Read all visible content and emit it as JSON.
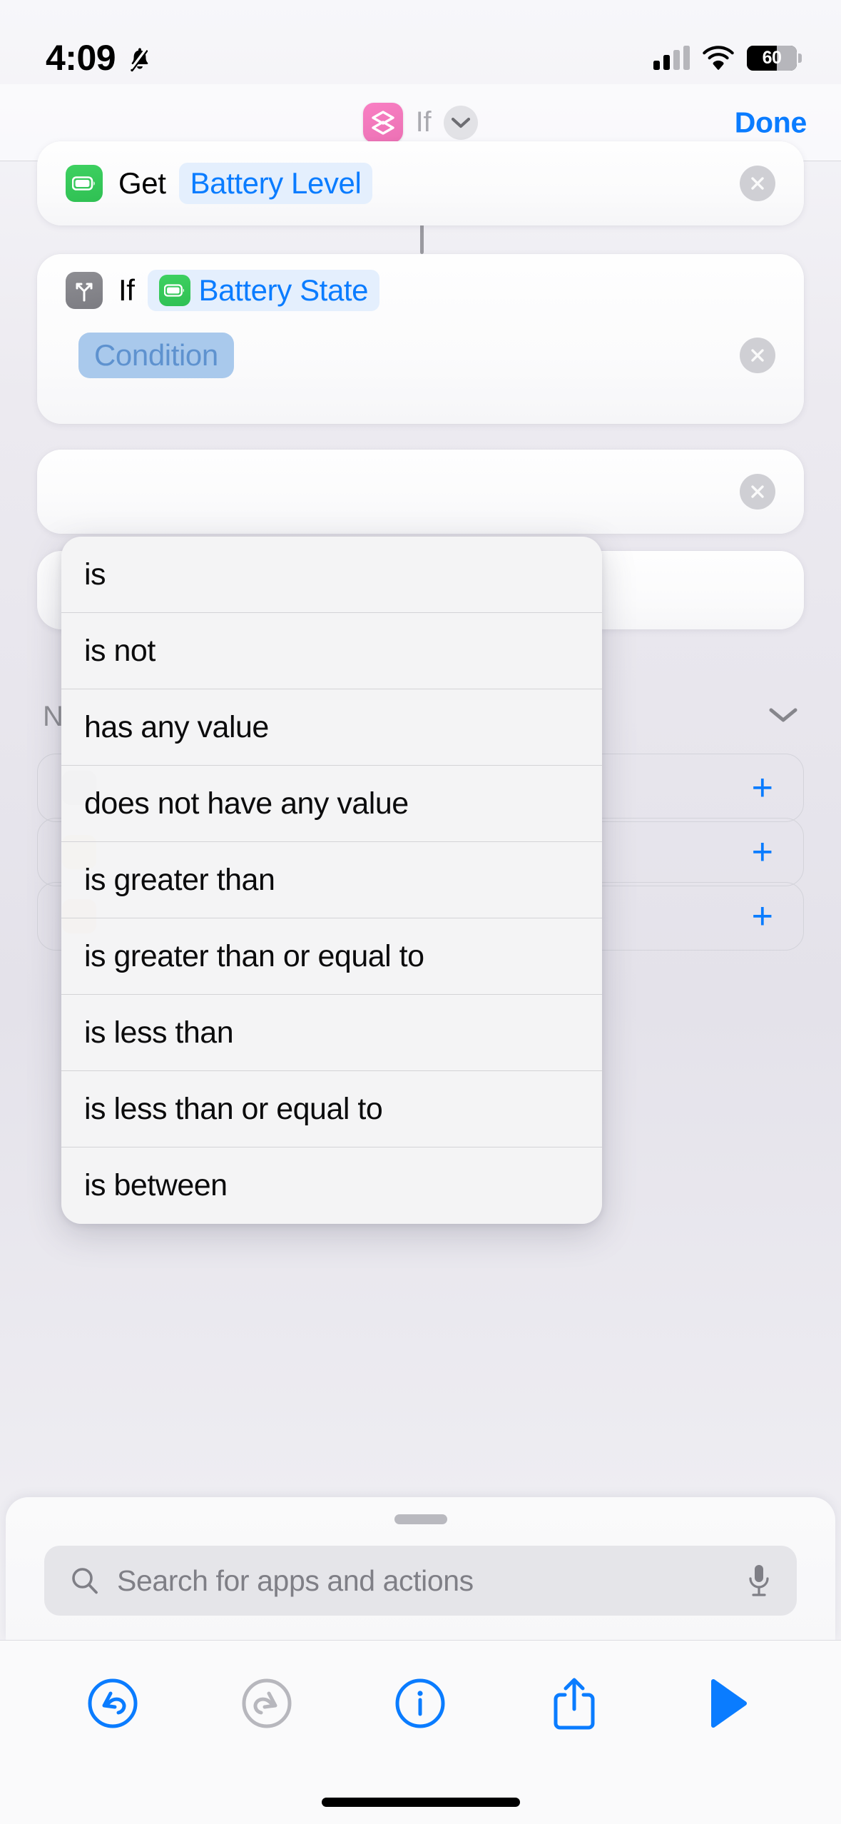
{
  "status_bar": {
    "time": "4:09",
    "silent_icon": "bell-slash-icon",
    "cellular_icon": "cellular-bars-icon",
    "wifi_icon": "wifi-icon",
    "battery_percent": "60",
    "battery_level": 60
  },
  "nav_bar": {
    "app_icon": "shortcuts-layers-icon",
    "title": "If",
    "chevron_icon": "chevron-down-icon",
    "done_label": "Done",
    "accent_color": "#0a7cff",
    "app_icon_color": "#f178bb"
  },
  "actions": [
    {
      "icon": "battery-icon",
      "icon_color": "#2fc053",
      "verb": "Get",
      "token": "Battery Level",
      "token_color": "#0a7cff",
      "close_icon": "close-circle-icon"
    },
    {
      "icon": "branch-icon",
      "icon_color": "#8e8e93",
      "verb": "If",
      "token_icon": "battery-icon",
      "token": "Battery State",
      "token_color": "#0a7cff",
      "condition_chip": "Condition",
      "condition_chip_color": "#a9c9ec",
      "close_icon": "close-circle-icon"
    }
  ],
  "obscured_section": {
    "title": "N",
    "collapse_icon": "chevron-down-icon",
    "rows": [
      {
        "icon": "gray-action-icon",
        "icon_color": "#7c7c82",
        "add_icon": "plus-icon"
      },
      {
        "icon": "amber-action-icon",
        "icon_color": "#e5a50a",
        "add_icon": "plus-icon"
      },
      {
        "icon": "orange-action-icon",
        "icon_color": "#e0700f",
        "add_icon": "plus-icon"
      }
    ]
  },
  "condition_menu": {
    "items": [
      "is",
      "is not",
      "has any value",
      "does not have any value",
      "is greater than",
      "is greater than or equal to",
      "is less than",
      "is less than or equal to",
      "is between"
    ]
  },
  "search_sheet": {
    "grabber": "sheet-grabber",
    "search_icon": "search-icon",
    "placeholder": "Search for apps and actions",
    "value": "",
    "mic_icon": "microphone-icon"
  },
  "toolbar": {
    "buttons": [
      {
        "name": "undo-button",
        "icon": "undo-icon",
        "enabled": true,
        "color": "#0a7cff"
      },
      {
        "name": "redo-button",
        "icon": "redo-icon",
        "enabled": false,
        "color": "#b7b7bd"
      },
      {
        "name": "info-button",
        "icon": "info-icon",
        "enabled": true,
        "color": "#0a7cff"
      },
      {
        "name": "share-button",
        "icon": "share-icon",
        "enabled": true,
        "color": "#0a7cff"
      },
      {
        "name": "play-button",
        "icon": "play-icon",
        "enabled": true,
        "color": "#0a7cff"
      }
    ]
  }
}
